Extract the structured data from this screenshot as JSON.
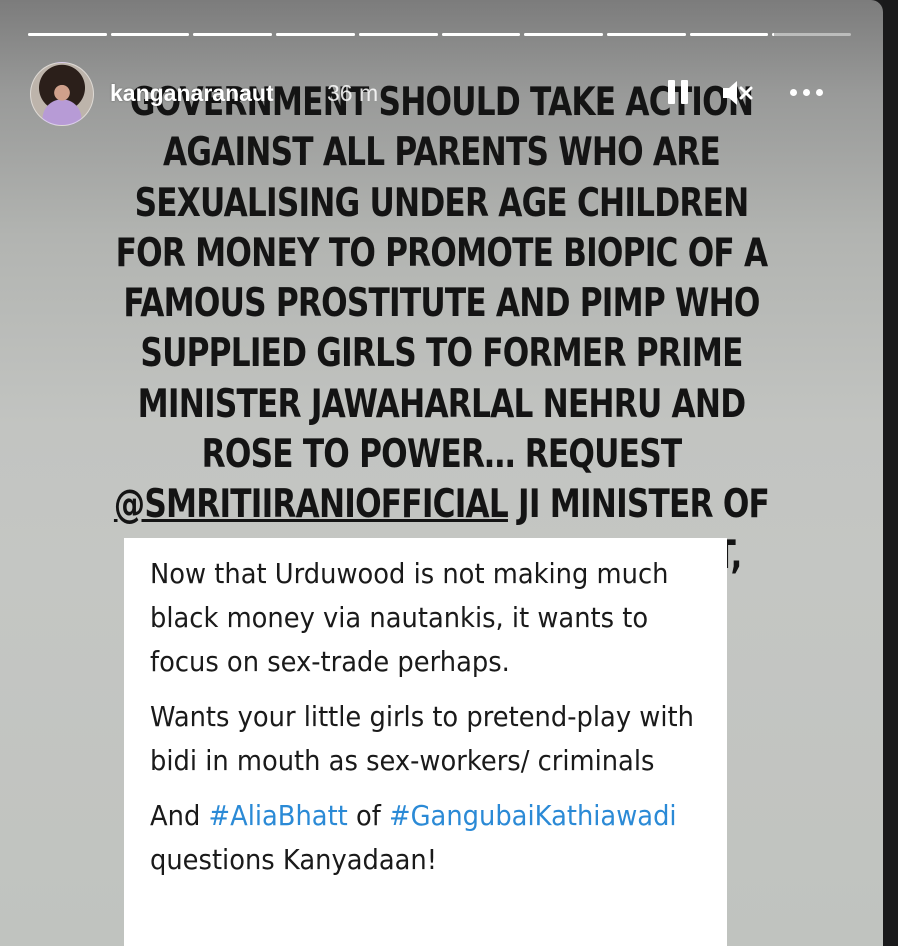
{
  "story": {
    "progress": [
      1,
      1,
      1,
      1,
      1,
      1,
      1,
      1,
      1,
      0.02
    ],
    "username": "kanganaranaut",
    "time": "36 m",
    "icons": {
      "pause": "pause-icon",
      "mute": "mute-icon",
      "more": "more-icon",
      "avatar": "profile-avatar",
      "emoji": "folded-hands"
    },
    "caption": {
      "text1": "GOVERNMENT SHOULD TAKE ACTION AGAINST ALL PARENTS WHO ARE SEXUALISING UNDER AGE CHILDREN FOR MONEY TO PROMOTE BIOPIC OF A FAMOUS PROSTITUTE AND PIMP WHO SUPPLIED GIRLS TO FORMER PRIME MINISTER JAWAHARLAL NEHRU AND ROSE TO POWER… REQUEST ",
      "mention": "@SMRITIIRANIOFFICIAL",
      "text2": " JI MINISTER OF WOMEN AND CHILD DEVELOPMENT, PLEASE LOOK IN TO IT ",
      "emoji": "🙏"
    },
    "tweet": {
      "para1": "Now that Urduwood is not making much black money via nautankis, it wants to focus on sex-trade perhaps.",
      "para2": "Wants your little girls to pretend-play with bidi in mouth as sex-workers/ criminals",
      "para3_pre": "And ",
      "hashtag1": "#AliaBhatt",
      "para3_mid": " of ",
      "hashtag2": "#GangubaiKathiawadi",
      "para3_post": " questions Kanyadaan!"
    }
  }
}
